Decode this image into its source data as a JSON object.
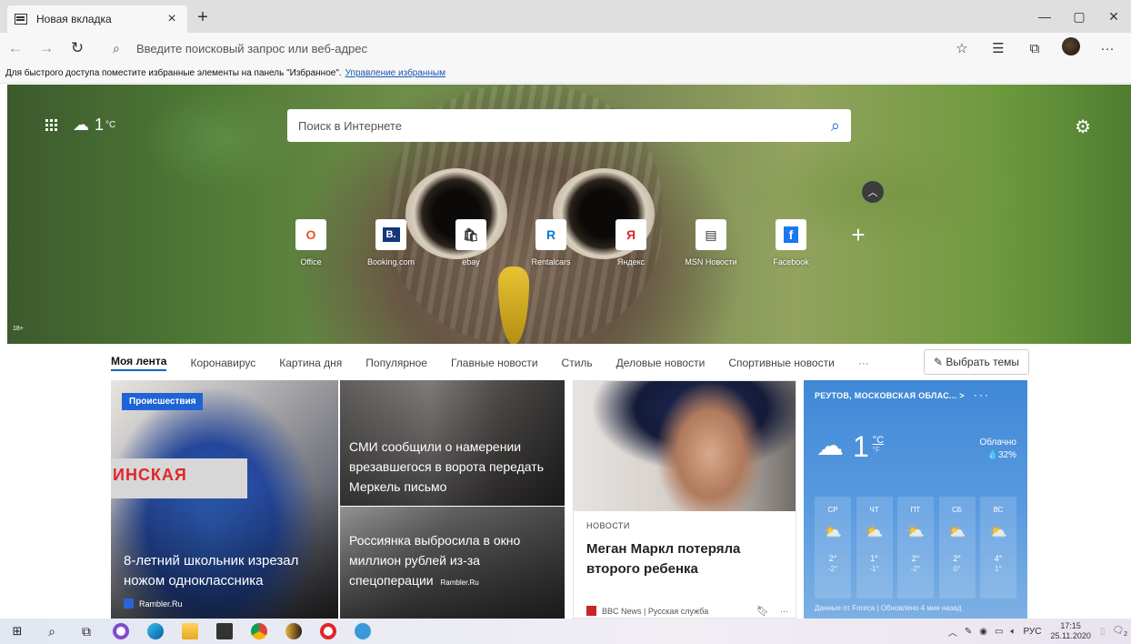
{
  "browser": {
    "tab_title": "Новая вкладка",
    "tab_close": "×",
    "new_tab": "+",
    "window_controls": [
      "—",
      "▢",
      "✕"
    ],
    "address_placeholder": "Введите поисковый запрос или веб-адрес",
    "favbar_text": "Для быстрого доступа поместите избранные элементы на панель \"Избранное\".",
    "favbar_link": "Управление избранным"
  },
  "hero": {
    "temperature": "1",
    "temperature_unit": "°C",
    "search_placeholder": "Поиск в Интернете",
    "age_badge": "18+",
    "quick_links": [
      {
        "label": "Office",
        "glyph": "O",
        "color": "#e4532b"
      },
      {
        "label": "Booking.com",
        "glyph": "B.",
        "color": "#17367a"
      },
      {
        "label": "ebay",
        "glyph": "🛍",
        "color": "#333333"
      },
      {
        "label": "Rentalcars",
        "glyph": "R",
        "color": "#0a7ad1"
      },
      {
        "label": "Яндекс",
        "glyph": "Я",
        "color": "#e0262b"
      },
      {
        "label": "MSN Новости",
        "glyph": "▤",
        "color": "#333333"
      },
      {
        "label": "Facebook",
        "glyph": "f",
        "color": "#1877f2"
      }
    ],
    "add_link": "+"
  },
  "feed_nav": {
    "items": [
      "Моя лента",
      "Коронавирус",
      "Картина дня",
      "Популярное",
      "Главные новости",
      "Стиль",
      "Деловые новости",
      "Спортивные новости"
    ],
    "more": "···",
    "topics_button": "✎ Выбрать темы"
  },
  "cards": {
    "c1": {
      "tag": "Происшествия",
      "photo_text": "ИНСКАЯ",
      "headline": "8-летний школьник изрезал ножом одноклассника",
      "source": "Rambler.Ru"
    },
    "c2": {
      "headline": "СМИ сообщили о намерении врезавшегося в ворота передать Меркель письмо"
    },
    "c3": {
      "headline": "Россиянка выбросила в окно миллион рублей из-за спецоперации",
      "source": "Rambler.Ru"
    },
    "c4": {
      "label": "НОВОСТИ",
      "headline": "Меган Маркл потеряла второго ребенка",
      "source": "BBC News | Русская служба",
      "more": "···"
    },
    "weather": {
      "location": "РЕУТОВ, МОСКОВСКАЯ ОБЛАС... >",
      "more": "· · ·",
      "temp": "1",
      "unit_c": "°C",
      "unit_f": "°F",
      "condition": "Облачно",
      "humidity": "💧32%",
      "days": [
        {
          "name": "СР",
          "hi": "2°",
          "lo": "-2°"
        },
        {
          "name": "ЧТ",
          "hi": "1°",
          "lo": "-1°"
        },
        {
          "name": "ПТ",
          "hi": "2°",
          "lo": "-2°"
        },
        {
          "name": "СБ",
          "hi": "2°",
          "lo": "0°"
        },
        {
          "name": "ВС",
          "hi": "4°",
          "lo": "1°"
        }
      ],
      "footer": "Данные от Foreca | Обновлено 4 мин назад"
    }
  },
  "taskbar": {
    "language": "РУС",
    "time": "17:15",
    "date": "25.11.2020",
    "notification_count": "2"
  }
}
